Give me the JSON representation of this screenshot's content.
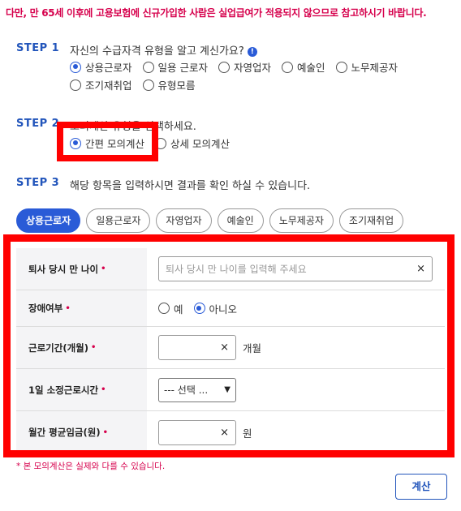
{
  "notice": "다만, 만 65세 이후에 고용보험에 신규가입한 사람은 실업급여가 적용되지 않으므로 참고하시기 바랍니다.",
  "step1": {
    "label": "STEP 1",
    "text": "자신의 수급자격 유형을 알고 계신가요?",
    "info_icon": "!",
    "options": [
      "상용근로자",
      "일용 근로자",
      "자영업자",
      "예술인",
      "노무제공자",
      "조기재취업",
      "유형모름"
    ],
    "selected": "상용근로자"
  },
  "step2": {
    "label": "STEP 2",
    "text": "모의계산 유형을 선택하세요.",
    "options": [
      "간편 모의계산",
      "상세 모의계산"
    ],
    "selected": "간편 모의계산"
  },
  "step3": {
    "label": "STEP 3",
    "text": "해당 항목을 입력하시면 결과를 확인 하실 수 있습니다."
  },
  "tabs": [
    "상용근로자",
    "일용근로자",
    "자영업자",
    "예술인",
    "노무제공자",
    "조기재취업"
  ],
  "active_tab": "상용근로자",
  "form": {
    "age": {
      "label": "퇴사 당시 만 나이",
      "placeholder": "퇴사 당시 만 나이를 입력해 주세요",
      "clear": "×"
    },
    "disability": {
      "label": "장애여부",
      "options": [
        "예",
        "아니오"
      ],
      "selected": "아니오"
    },
    "period": {
      "label": "근로기간(개월)",
      "unit": "개월",
      "clear": "×"
    },
    "hours": {
      "label": "1일 소정근로시간",
      "selected_value": "--- 선택 ...",
      "chevron": "⌄"
    },
    "wage": {
      "label": "월간 평균임금(원)",
      "unit": "원",
      "clear": "×"
    },
    "required_mark": "•"
  },
  "footnote": "* 본 모의계산은 실제와 다를 수 있습니다.",
  "calc_button": "계산",
  "colors": {
    "accent": "#2a5bd7",
    "notice": "#d6004c",
    "highlight": "#ff0000"
  }
}
